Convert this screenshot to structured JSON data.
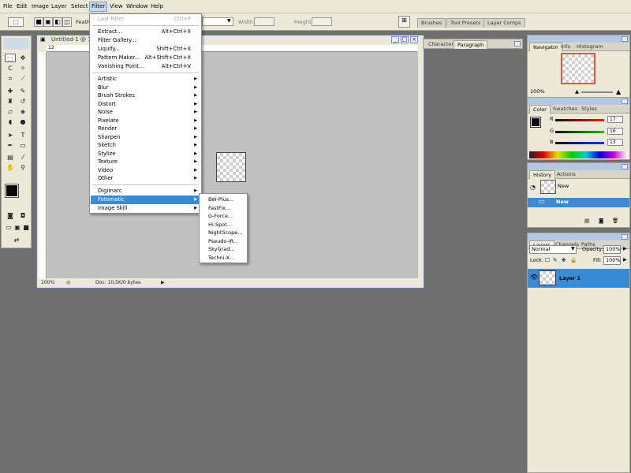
{
  "menubar": {
    "items": [
      "File",
      "Edit",
      "Image",
      "Layer",
      "Select",
      "Filter",
      "View",
      "Window",
      "Help"
    ],
    "active": "Filter"
  },
  "options_bar": {
    "feather_label": "Feath",
    "width_label": "Width:",
    "height_label": "Height:",
    "well_tabs": [
      "Brushes",
      "Tool Presets",
      "Layer Comps"
    ]
  },
  "document": {
    "title": "Untitled-1 @ 1",
    "ruler_top_first": "12",
    "zoom": "100%",
    "doc_info": "Doc: 10,5K/0 bytes"
  },
  "filter_menu": {
    "items": [
      {
        "label": "Last Filter",
        "shortcut": "Ctrl+F",
        "disabled": true
      },
      {
        "sep": true
      },
      {
        "label": "Extract...",
        "shortcut": "Alt+Ctrl+X"
      },
      {
        "label": "Filter Gallery..."
      },
      {
        "label": "Liquify...",
        "shortcut": "Shift+Ctrl+X"
      },
      {
        "label": "Pattern Maker...",
        "shortcut": "Alt+Shift+Ctrl+X"
      },
      {
        "label": "Vanishing Point...",
        "shortcut": "Alt+Ctrl+V"
      },
      {
        "sep": true
      },
      {
        "label": "Artistic",
        "submenu": true
      },
      {
        "label": "Blur",
        "submenu": true
      },
      {
        "label": "Brush Strokes",
        "submenu": true
      },
      {
        "label": "Distort",
        "submenu": true
      },
      {
        "label": "Noise",
        "submenu": true
      },
      {
        "label": "Pixelate",
        "submenu": true
      },
      {
        "label": "Render",
        "submenu": true
      },
      {
        "label": "Sharpen",
        "submenu": true
      },
      {
        "label": "Sketch",
        "submenu": true
      },
      {
        "label": "Stylize",
        "submenu": true
      },
      {
        "label": "Texture",
        "submenu": true
      },
      {
        "label": "Video",
        "submenu": true
      },
      {
        "label": "Other",
        "submenu": true
      },
      {
        "sep": true
      },
      {
        "label": "Digimarc",
        "submenu": true
      },
      {
        "label": "Fotomatic",
        "submenu": true,
        "highlighted": true
      },
      {
        "label": "Image Skill",
        "submenu": true
      }
    ]
  },
  "fotomatic_submenu": {
    "items": [
      "BW-Plus...",
      "FastFix...",
      "G-Force...",
      "Hi-Spot...",
      "NightScope...",
      "Pseudo-IR...",
      "SkyGrad...",
      "Techni-X..."
    ]
  },
  "char_palette": {
    "tabs": [
      "Character",
      "Paragraph"
    ],
    "active": "Paragraph"
  },
  "navigator": {
    "tabs": [
      "Navigator",
      "Info",
      "Histogram"
    ],
    "zoom": "100%"
  },
  "color": {
    "tabs": [
      "Color",
      "Swatches",
      "Styles"
    ],
    "channels": [
      {
        "label": "R",
        "value": "17",
        "color": "#cc0000"
      },
      {
        "label": "G",
        "value": "16",
        "color": "#00aa00"
      },
      {
        "label": "B",
        "value": "13",
        "color": "#0000cc"
      }
    ],
    "foreground": "#110f0d"
  },
  "history": {
    "tabs": [
      "History",
      "Actions"
    ],
    "snapshot_label": "New",
    "state_label": "New"
  },
  "layers": {
    "tabs": [
      "Layers",
      "Channels",
      "Paths"
    ],
    "blend_mode": "Normal",
    "opacity_label": "Opacity:",
    "opacity": "100%",
    "lock_label": "Lock:",
    "fill_label": "Fill:",
    "fill": "100%",
    "layer_name": "Layer 1"
  },
  "colors": {
    "highlight": "#3a8bd6",
    "ui_bg": "#ece9d8",
    "workspace": "#6f6f6f"
  }
}
